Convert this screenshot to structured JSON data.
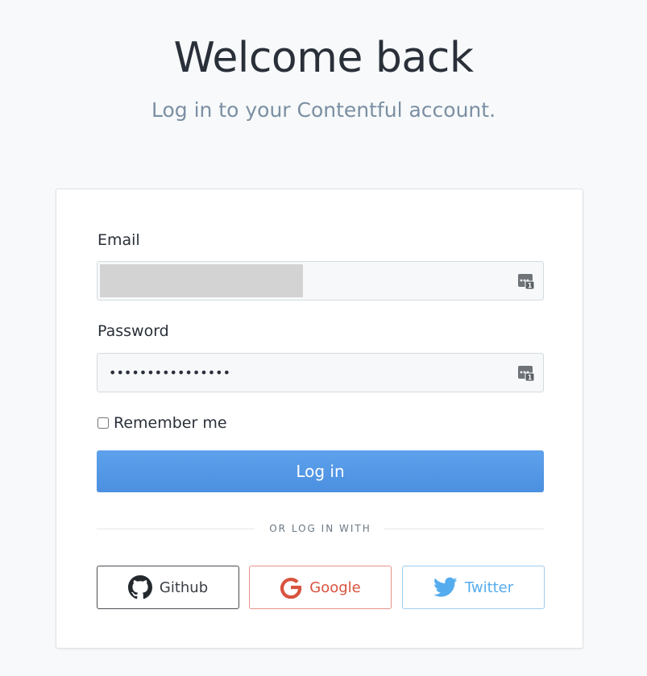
{
  "header": {
    "title": "Welcome back",
    "subtitle": "Log in to your Contentful account."
  },
  "form": {
    "email_label": "Email",
    "email_value": "",
    "password_label": "Password",
    "password_value": "••••••••••••••••",
    "remember_label": "Remember me",
    "remember_checked": false,
    "login_label": "Log in",
    "divider_text": "OR LOG IN WITH"
  },
  "social": {
    "github_label": "Github",
    "google_label": "Google",
    "twitter_label": "Twitter"
  },
  "icons": {
    "password_manager": "password-manager-icon",
    "github": "github-icon",
    "google": "google-icon",
    "twitter": "twitter-icon"
  },
  "colors": {
    "background": "#f7f9fa",
    "primary": "#4b8fe0",
    "github": "#3a3f45",
    "google": "#d9533f",
    "twitter": "#55acee"
  }
}
